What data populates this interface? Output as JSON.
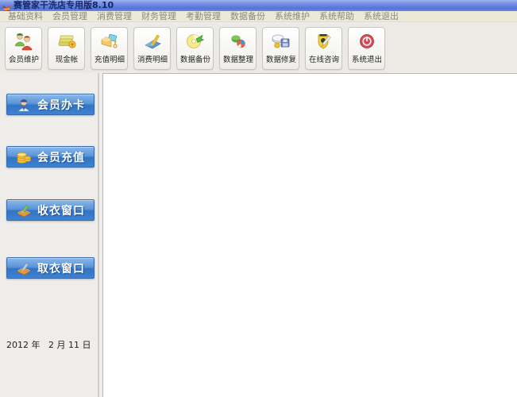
{
  "window": {
    "title": "赛管家干洗店专用版8.10"
  },
  "menu": {
    "items": [
      "基础资料",
      "会员管理",
      "消费管理",
      "财务管理",
      "考勤管理",
      "数据备份",
      "系统维护",
      "系统帮助",
      "系统退出"
    ]
  },
  "toolbar": {
    "buttons": [
      {
        "label": "会员维护",
        "icon": "members-icon"
      },
      {
        "label": "现金帐",
        "icon": "cash-icon"
      },
      {
        "label": "充值明细",
        "icon": "recharge-detail-icon"
      },
      {
        "label": "消费明细",
        "icon": "consume-detail-icon"
      },
      {
        "label": "数据备份",
        "icon": "data-backup-icon"
      },
      {
        "label": "数据整理",
        "icon": "data-organize-icon"
      },
      {
        "label": "数据修复",
        "icon": "data-repair-icon"
      },
      {
        "label": "在线咨询",
        "icon": "online-consult-icon"
      },
      {
        "label": "系统退出",
        "icon": "system-exit-icon"
      }
    ]
  },
  "sidebar": {
    "buttons": [
      {
        "label": "会员办卡",
        "icon": "member-card-icon"
      },
      {
        "label": "会员充值",
        "icon": "member-recharge-icon"
      },
      {
        "label": "收衣窗口",
        "icon": "receive-clothes-icon"
      },
      {
        "label": "取衣窗口",
        "icon": "pickup-clothes-icon"
      }
    ]
  },
  "statusbar": {
    "date": "2012 年   2 月 11 日"
  },
  "colors": {
    "titlebar_blue": "#5374d6",
    "menubar_beige": "#ece9d8",
    "sidebar_button_blue": "#3f82d2",
    "exit_red": "#d84a55"
  }
}
